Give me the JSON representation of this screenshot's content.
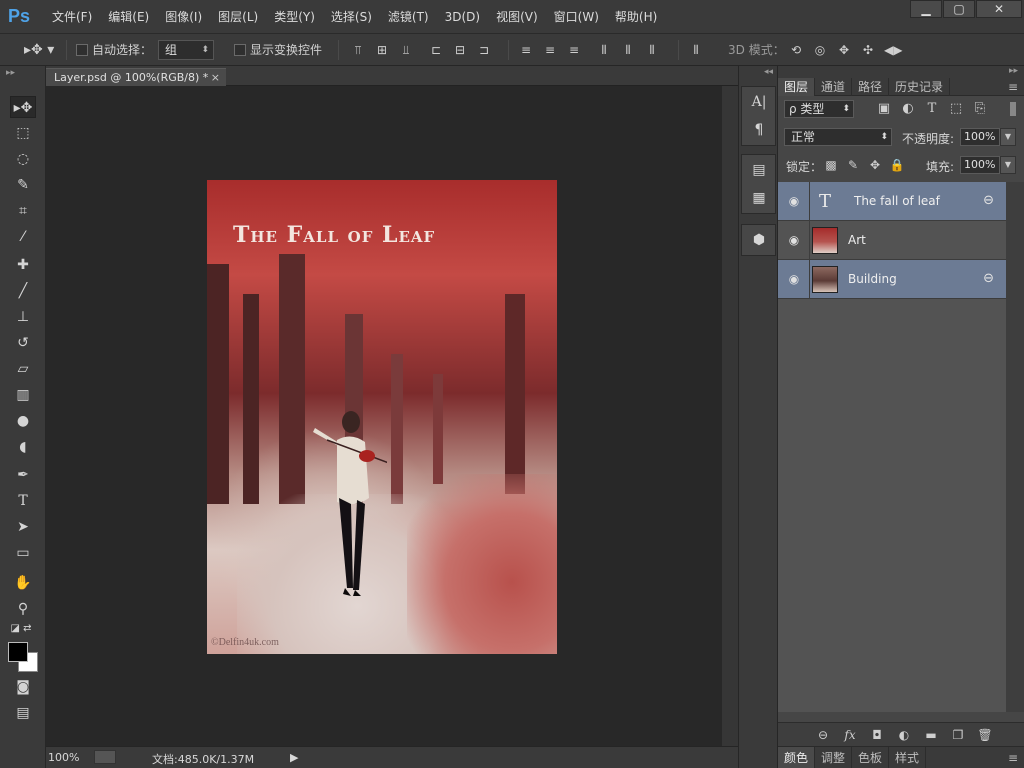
{
  "app": {
    "logo": "Ps"
  },
  "menu": [
    "文件(F)",
    "编辑(E)",
    "图像(I)",
    "图层(L)",
    "类型(Y)",
    "选择(S)",
    "滤镜(T)",
    "3D(D)",
    "视图(V)",
    "窗口(W)",
    "帮助(H)"
  ],
  "window_controls": {
    "minimize": "▁",
    "maximize": "▢",
    "close": "✕"
  },
  "options": {
    "auto_select_label": "自动选择：",
    "auto_select_value": "组",
    "show_transform_label": "显示变换控件",
    "mode_3d_label": "3D 模式："
  },
  "document": {
    "tab_title": "Layer.psd @ 100%(RGB/8) *",
    "tab_close": "×",
    "canvas_title": "The Fall of Leaf",
    "watermark": "©Delfin4uk.com"
  },
  "status": {
    "zoom": "100%",
    "doc_size": "文档:485.0K/1.37M",
    "arrow": "▶"
  },
  "layers_panel": {
    "tabs": [
      "图层",
      "通道",
      "路径",
      "历史记录"
    ],
    "filter_label": "ρ 类型",
    "blend_mode": "正常",
    "opacity_label": "不透明度:",
    "opacity_value": "100%",
    "lock_label": "锁定：",
    "fill_label": "填充:",
    "fill_value": "100%",
    "layers": [
      {
        "name": "The fall of leaf",
        "thumb": "T"
      },
      {
        "name": "Art"
      },
      {
        "name": "Building"
      }
    ]
  },
  "bottom_tabs": [
    "颜色",
    "调整",
    "色板",
    "样式"
  ],
  "colors": {
    "accent_selection": "#6c7b94",
    "ps_blue": "#4fa3e8",
    "foreground": "#000000",
    "background": "#ffffff"
  }
}
